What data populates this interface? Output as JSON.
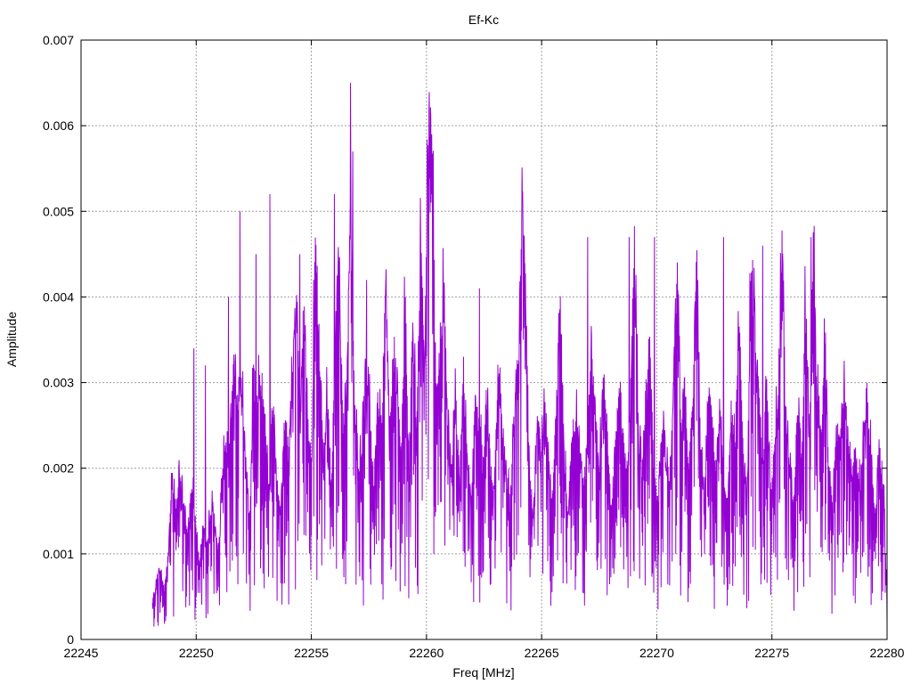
{
  "chart_data": {
    "type": "line",
    "title": "Ef-Kc",
    "xlabel": "Freq [MHz]",
    "ylabel": "Amplitude",
    "xlim": [
      22245,
      22280
    ],
    "ylim": [
      0,
      0.007
    ],
    "xticks": [
      "22245",
      "22250",
      "22255",
      "22260",
      "22265",
      "22270",
      "22275",
      "22280"
    ],
    "yticks": [
      "0",
      "0.001",
      "0.002",
      "0.003",
      "0.004",
      "0.005",
      "0.006",
      "0.007"
    ],
    "grid": true,
    "line_color": "#9400d3",
    "series": [
      {
        "x_start": 22248.1,
        "x_end": 22280.0,
        "peaks": [
          [
            22249.9,
            0.0034
          ],
          [
            22250.4,
            0.0032
          ],
          [
            22251.4,
            0.004
          ],
          [
            22251.9,
            0.005
          ],
          [
            22252.6,
            0.0045
          ],
          [
            22253.2,
            0.0052
          ],
          [
            22254.5,
            0.0045
          ],
          [
            22255.1,
            0.0042
          ],
          [
            22256.0,
            0.0052
          ],
          [
            22256.7,
            0.0065
          ],
          [
            22256.8,
            0.0057
          ],
          [
            22257.4,
            0.0042
          ],
          [
            22260.2,
            0.0051
          ],
          [
            22260.1,
            0.0042
          ],
          [
            22262.3,
            0.0041
          ],
          [
            22267.0,
            0.0047
          ],
          [
            22268.8,
            0.0047
          ],
          [
            22269.9,
            0.0047
          ],
          [
            22272.9,
            0.0047
          ],
          [
            22274.6,
            0.0046
          ],
          [
            22276.7,
            0.0047
          ]
        ],
        "values": [
          0.00045,
          0.0007,
          0.00085,
          0.0006,
          0.001,
          0.002,
          0.0014,
          0.0021,
          0.0016,
          0.0012,
          0.0018,
          0.0015,
          0.0009,
          0.0013,
          0.0011,
          0.0016,
          0.0014,
          0.001,
          0.0019,
          0.0024,
          0.0025,
          0.0034,
          0.0029,
          0.003,
          0.002,
          0.0015,
          0.0032,
          0.0028,
          0.0031,
          0.0026,
          0.0018,
          0.0029,
          0.002,
          0.0015,
          0.0027,
          0.0023,
          0.0032,
          0.0038,
          0.0028,
          0.004,
          0.0025,
          0.002,
          0.005,
          0.0033,
          0.0022,
          0.0029,
          0.0018,
          0.0035,
          0.0045,
          0.0026,
          0.0031,
          0.0052,
          0.0028,
          0.002,
          0.0024,
          0.0033,
          0.0026,
          0.0018,
          0.0029,
          0.0024,
          0.0045,
          0.0022,
          0.0035,
          0.003,
          0.0021,
          0.004,
          0.002,
          0.0038,
          0.0025,
          0.0048,
          0.003,
          0.0065,
          0.0057,
          0.0028,
          0.0035,
          0.0042,
          0.0025,
          0.002,
          0.003,
          0.0018,
          0.0032,
          0.0022,
          0.0016,
          0.0028,
          0.0025,
          0.0021,
          0.003,
          0.002,
          0.0018,
          0.0033,
          0.0025,
          0.002,
          0.0016,
          0.0027,
          0.003,
          0.0051,
          0.0042,
          0.002,
          0.0015,
          0.0026,
          0.0023,
          0.0028,
          0.002,
          0.0017,
          0.0029,
          0.0041,
          0.0021,
          0.0015,
          0.0025,
          0.0026,
          0.0022,
          0.0018,
          0.0024,
          0.0035,
          0.0026,
          0.002,
          0.003,
          0.0025,
          0.0015,
          0.0022,
          0.0032,
          0.0024,
          0.002,
          0.0028,
          0.0047,
          0.0025,
          0.002,
          0.003,
          0.0034,
          0.002,
          0.0016,
          0.0026,
          0.0023,
          0.0018,
          0.0028,
          0.0047,
          0.0025,
          0.0031,
          0.002,
          0.0028,
          0.0047,
          0.0022,
          0.0017,
          0.003,
          0.0025,
          0.0021,
          0.0028,
          0.002,
          0.0016,
          0.0028,
          0.0024,
          0.004,
          0.0022,
          0.0016,
          0.0047,
          0.0038,
          0.0028,
          0.0021,
          0.003,
          0.0018,
          0.0022,
          0.003,
          0.0046,
          0.0025,
          0.002,
          0.0016,
          0.0028,
          0.0022,
          0.004,
          0.0025,
          0.0047,
          0.003,
          0.0023,
          0.0038,
          0.002,
          0.0015,
          0.0026,
          0.0023,
          0.0029,
          0.0024,
          0.002,
          0.0023,
          0.0018,
          0.0024,
          0.0027,
          0.0021,
          0.0015,
          0.0022,
          0.0019,
          0.0005
        ]
      }
    ]
  }
}
